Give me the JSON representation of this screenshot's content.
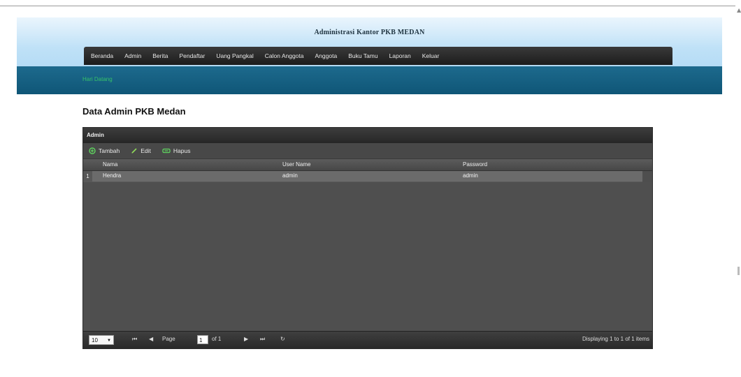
{
  "header": {
    "title": "Administrasi Kantor PKB MEDAN"
  },
  "menu": [
    "Beranda",
    "Admin",
    "Berita",
    "Pendaftar",
    "Uang Pangkal",
    "Calon Anggota",
    "Anggota",
    "Buku Tamu",
    "Laporan",
    "Keluar"
  ],
  "subnav": {
    "link": "Hari Datang"
  },
  "page_title": "Data Admin PKB Medan",
  "grid": {
    "title": "Admin",
    "toolbar": {
      "add": "Tambah",
      "edit": "Edit",
      "delete": "Hapus"
    },
    "columns": [
      "Nama",
      "User Name",
      "Password"
    ],
    "rows": [
      {
        "num": "1",
        "nama": "Hendra",
        "username": "admin",
        "password": "admin"
      }
    ],
    "pager": {
      "page_size": "10",
      "page_label": "Page",
      "page_value": "1",
      "of_label": "of 1",
      "display": "Displaying 1 to 1 of 1 items"
    }
  },
  "icons": {
    "add": "plus-circle-icon",
    "edit": "pencil-icon",
    "delete": "minus-box-icon"
  },
  "colors": {
    "accent_green": "#36c26a",
    "menubar": "#262626",
    "subnav": "#135f82"
  }
}
